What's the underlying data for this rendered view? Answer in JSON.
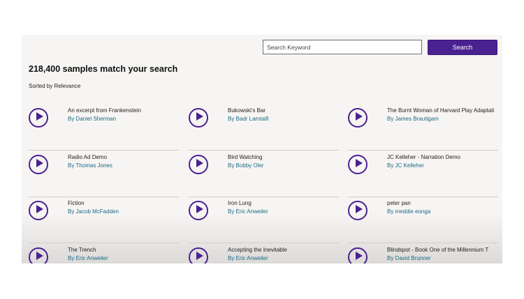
{
  "search": {
    "placeholder": "Search Keyword",
    "value": "",
    "button_label": "Search"
  },
  "results": {
    "heading": "218,400 samples match your search",
    "sort_label": "Sorted by Relevance"
  },
  "accent_color": "#4a2191",
  "author_link_color": "#1a6a86",
  "samples": [
    {
      "title": "An excerpt from Frankenstein",
      "author": "By Daniel Sherman"
    },
    {
      "title": "Bukowski's Bar",
      "author": "By Badr Lamtaifi"
    },
    {
      "title": "The Burnt Woman of Harvard Play Adaptati",
      "author": "By James Brautigam"
    },
    {
      "title": "Radio Ad Demo",
      "author": "By Thomas Jones"
    },
    {
      "title": "Bird Watching",
      "author": "By Bobby Oler"
    },
    {
      "title": "JC Kelleher - Narration Demo",
      "author": "By JC Kelleher"
    },
    {
      "title": "Fiction",
      "author": "By Jacob McFadden"
    },
    {
      "title": "Iron Lung",
      "author": "By Eric Anweiler"
    },
    {
      "title": "peter pan",
      "author": "By meddie eonga"
    },
    {
      "title": "The Trench",
      "author": "By Eric Anweiler"
    },
    {
      "title": "Accepting the Inevitable",
      "author": "By Eric Anweiler"
    },
    {
      "title": "Blindspot - Book One of the Millennium T",
      "author": "By David Brunner"
    }
  ],
  "play_icon": "play-circle-icon"
}
